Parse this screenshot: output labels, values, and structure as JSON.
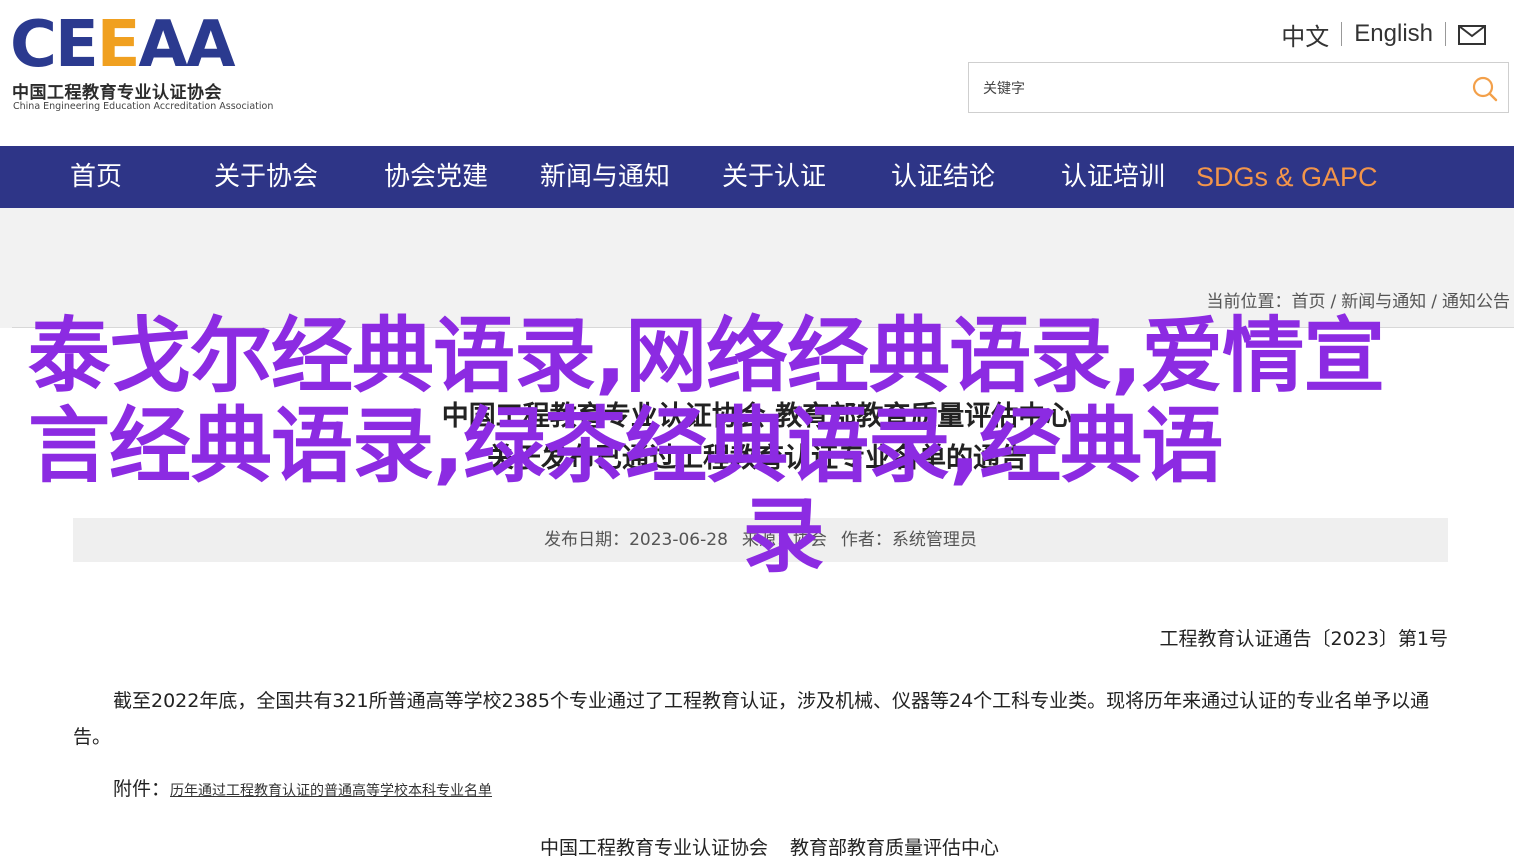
{
  "logo": {
    "letters": [
      "C",
      "E",
      "E",
      "A",
      "A"
    ],
    "cn_name": "中国工程教育专业认证协会",
    "en_name": "China Engineering Education Accreditation Association"
  },
  "top_links": {
    "chinese": "中文",
    "english": "English",
    "mail_icon": "mail-icon"
  },
  "search": {
    "placeholder": "关键字",
    "value": "",
    "icon": "search-icon",
    "icon_color": "#f3a04a"
  },
  "nav": {
    "bg_color": "#2e3587",
    "highlight_color": "#f3954a",
    "items": [
      {
        "label": "首页"
      },
      {
        "label": "关于协会"
      },
      {
        "label": "协会党建"
      },
      {
        "label": "新闻与通知"
      },
      {
        "label": "关于认证"
      },
      {
        "label": "认证结论"
      },
      {
        "label": "认证培训"
      },
      {
        "label": "SDGs & GAPC"
      }
    ]
  },
  "breadcrumb": {
    "prefix": "当前位置：",
    "items": [
      "首页",
      "新闻与通知",
      "通知公告"
    ]
  },
  "article": {
    "title_line1": "中国工程教育专业认证协会 教育部教育质量评估中心",
    "title_line2": "关于发布已通过工程教育认证专业名单的通告",
    "meta": {
      "date_label": "发布日期：",
      "date": "2023-06-28",
      "source_label": "来源：",
      "source": "协会",
      "author_label": "作者：",
      "author": "系统管理员"
    },
    "notice_no": "工程教育认证通告〔2023〕第1号",
    "paragraph": "截至2022年底，全国共有321所普通高等学校2385个专业通过了工程教育认证，涉及机械、仪器等24个工科专业类。现将历年来通过认证的专业名单予以通告。",
    "attach_label": "附件：",
    "attach_link": "历年通过工程教育认证的普通高等学校本科专业名单",
    "sign_org1": "中国工程教育专业认证协会",
    "sign_org2": "教育部教育质量评估中心"
  },
  "overlay": {
    "text": "泰戈尔经典语录,网络经典语录,爱情宣言经典语录,绿茶经典语录,经典语",
    "last": "录",
    "color": "#8c2be2"
  }
}
